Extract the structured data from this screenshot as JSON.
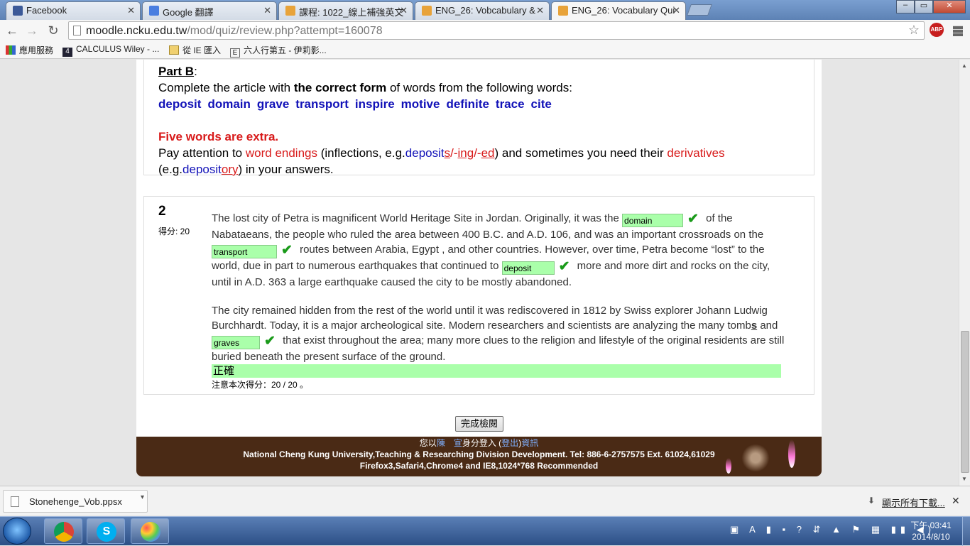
{
  "tabs": [
    {
      "label": "Facebook"
    },
    {
      "label": "Google 翻譯"
    },
    {
      "label": "課程: 1022_線上補強英文"
    },
    {
      "label": "ENG_26: Vobcabulary &"
    },
    {
      "label": "ENG_26: Vocabulary Qui"
    }
  ],
  "window_controls": {
    "minimize": "–",
    "restore": "▭",
    "close": "✕"
  },
  "url": {
    "host": "moodle.ncku.edu.tw",
    "path": "/mod/quiz/review.php?attempt=160078"
  },
  "bookmarks": [
    "應用服務",
    "CALCULUS Wiley - ...",
    "從 IE 匯入",
    "六人行第五 - 伊莉影..."
  ],
  "part_b": {
    "heading": "Part B",
    "heading_colon": ":",
    "instr_1": "Complete the article with ",
    "instr_bold": "the correct form",
    "instr_2": " of  words from the following words:",
    "words": [
      "deposit",
      "domain",
      "grave",
      "transport",
      "inspire",
      "motive",
      "definite",
      "trace",
      "cite"
    ],
    "extra": "Five words are extra.",
    "attn_1": "Pay attention to ",
    "word_endings": "word endings",
    "attn_2": " (inflections, e.g.",
    "ex1": "deposit",
    "ex_s": "s",
    "sep1": "/-",
    "ex_ing": "ing",
    "sep2": "/-",
    "ex_ed": "ed",
    "attn_3": ") and sometimes you need their ",
    "derivatives": "derivatives",
    "attn_4": "(e.g.",
    "ex2": "deposit",
    "ex_ory": "ory",
    "attn_5": ") in your answers."
  },
  "question": {
    "number": "2",
    "score_label": "得分: 20",
    "p1_a": "The lost city of Petra is magnificent World Heritage Site in Jordan. Originally, it was the ",
    "ans1": "domain",
    "p1_b": " of the Nabataeans, the people who ruled the area between 400 B.C. and A.D. 106, and was an important crossroads on the ",
    "ans2": "transport",
    "p1_c": " routes between Arabia, Egypt , and other countries.  However, over time, Petra become “lost” to the world, due in part to numerous earthquakes that continued to ",
    "ans3": "deposit",
    "p1_d": " more and more dirt and rocks on the city, until in A.D. 363 a large earthquake caused the city to be mostly abandoned.",
    "p2_a": "The city remained hidden from the rest of the world until it was rediscovered in 1812 by Swiss explorer Johann Ludwig Burchhardt. Today, it is a major archeological site. Modern researchers and scientists are analyzing the many tomb",
    "p2_s": "s",
    "p2_b": " and ",
    "ans4": "graves",
    "p2_c": " that exist throughout the area; many more clues to the religion and lifestyle of the original residents are still buried beneath the present surface of the ground.",
    "check": "✔",
    "correct_label": "正確",
    "score_note": "注意本次得分：20 / 20 。"
  },
  "finish_button": "完成檢閱",
  "footer": {
    "l1_a": "您以",
    "l1_user": "陳　宣",
    "l1_b": "身分登入 (",
    "l1_logout": "登出",
    "l1_c": ")",
    "l1_info": "資訊",
    "l2": "National Cheng Kung University,Teaching & Researching Division Development. Tel: 886-6-2757575 Ext. 61024,61029",
    "l3": "Firefox3,Safari4,Chrome4 and IE8,1024*768 Recommended"
  },
  "download": {
    "file": "Stonehenge_Vob.ppsx",
    "show_all": "顯示所有下載..."
  },
  "clock": {
    "time": "下午 03:41",
    "date": "2014/8/10"
  },
  "tray_text": "A ? ",
  "colors": {
    "correct_bg": "#aaffaa",
    "footer_bg": "#4a2a15",
    "word_blue": "#1212b8",
    "alert_red": "#d81a1a"
  }
}
